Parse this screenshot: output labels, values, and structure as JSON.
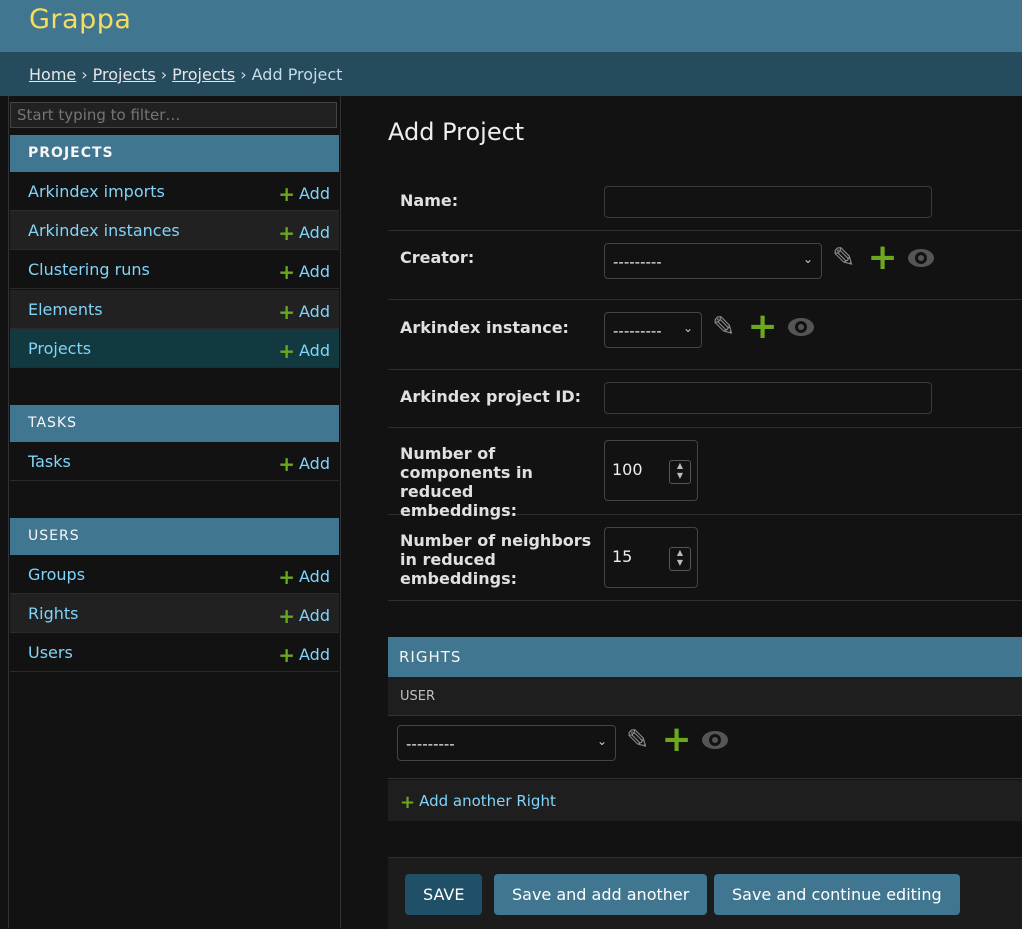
{
  "brand": "Grappa",
  "breadcrumb": {
    "items": [
      "Home",
      "Projects",
      "Projects"
    ],
    "separator": "›",
    "current": "Add Project"
  },
  "sidebar": {
    "filter_placeholder": "Start typing to filter…",
    "add_label": "Add",
    "projects": {
      "title": "PROJECTS",
      "items": [
        "Arkindex imports",
        "Arkindex instances",
        "Clustering runs",
        "Elements",
        "Projects"
      ]
    },
    "tasks": {
      "title": "TASKS",
      "items": [
        "Tasks"
      ]
    },
    "users": {
      "title": "USERS",
      "items": [
        "Groups",
        "Rights",
        "Users"
      ]
    }
  },
  "form": {
    "title": "Add Project",
    "name_label": "Name:",
    "creator_label": "Creator:",
    "creator_value": "---------",
    "instance_label": "Arkindex instance:",
    "instance_value": "---------",
    "project_id_label": "Arkindex project ID:",
    "components_label": "Number of components in reduced embeddings:",
    "components_value": "100",
    "neighbors_label": "Number of neighbors in reduced embeddings:",
    "neighbors_value": "15"
  },
  "rights": {
    "title": "RIGHTS",
    "user_column": "USER",
    "user_value": "---------",
    "add_another": "Add another Right"
  },
  "buttons": {
    "save": "Save",
    "save_add": "Save and add another",
    "save_continue": "Save and continue editing"
  },
  "colors": {
    "header": "#417690",
    "breadcrumb_bar": "#264b5d",
    "brand": "#f5dd5d",
    "link": "#81d4fa",
    "add_green": "#6ca81d",
    "selected_row": "#12393f"
  },
  "icons": {
    "change": "pencil-icon",
    "add": "plus-icon",
    "view": "eye-icon"
  }
}
